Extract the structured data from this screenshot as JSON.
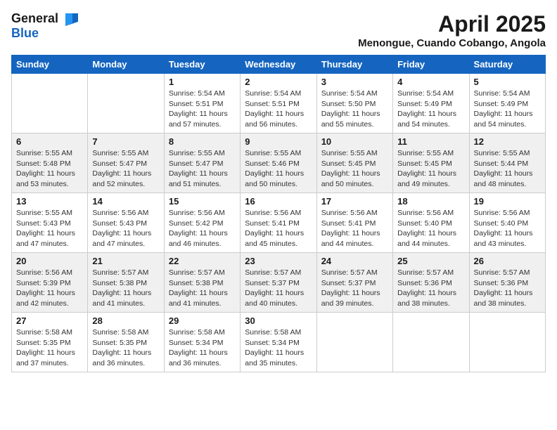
{
  "logo": {
    "general": "General",
    "blue": "Blue"
  },
  "title": "April 2025",
  "subtitle": "Menongue, Cuando Cobango, Angola",
  "days_header": [
    "Sunday",
    "Monday",
    "Tuesday",
    "Wednesday",
    "Thursday",
    "Friday",
    "Saturday"
  ],
  "weeks": [
    [
      {
        "num": "",
        "sunrise": "",
        "sunset": "",
        "daylight": ""
      },
      {
        "num": "",
        "sunrise": "",
        "sunset": "",
        "daylight": ""
      },
      {
        "num": "1",
        "sunrise": "Sunrise: 5:54 AM",
        "sunset": "Sunset: 5:51 PM",
        "daylight": "Daylight: 11 hours and 57 minutes."
      },
      {
        "num": "2",
        "sunrise": "Sunrise: 5:54 AM",
        "sunset": "Sunset: 5:51 PM",
        "daylight": "Daylight: 11 hours and 56 minutes."
      },
      {
        "num": "3",
        "sunrise": "Sunrise: 5:54 AM",
        "sunset": "Sunset: 5:50 PM",
        "daylight": "Daylight: 11 hours and 55 minutes."
      },
      {
        "num": "4",
        "sunrise": "Sunrise: 5:54 AM",
        "sunset": "Sunset: 5:49 PM",
        "daylight": "Daylight: 11 hours and 54 minutes."
      },
      {
        "num": "5",
        "sunrise": "Sunrise: 5:54 AM",
        "sunset": "Sunset: 5:49 PM",
        "daylight": "Daylight: 11 hours and 54 minutes."
      }
    ],
    [
      {
        "num": "6",
        "sunrise": "Sunrise: 5:55 AM",
        "sunset": "Sunset: 5:48 PM",
        "daylight": "Daylight: 11 hours and 53 minutes."
      },
      {
        "num": "7",
        "sunrise": "Sunrise: 5:55 AM",
        "sunset": "Sunset: 5:47 PM",
        "daylight": "Daylight: 11 hours and 52 minutes."
      },
      {
        "num": "8",
        "sunrise": "Sunrise: 5:55 AM",
        "sunset": "Sunset: 5:47 PM",
        "daylight": "Daylight: 11 hours and 51 minutes."
      },
      {
        "num": "9",
        "sunrise": "Sunrise: 5:55 AM",
        "sunset": "Sunset: 5:46 PM",
        "daylight": "Daylight: 11 hours and 50 minutes."
      },
      {
        "num": "10",
        "sunrise": "Sunrise: 5:55 AM",
        "sunset": "Sunset: 5:45 PM",
        "daylight": "Daylight: 11 hours and 50 minutes."
      },
      {
        "num": "11",
        "sunrise": "Sunrise: 5:55 AM",
        "sunset": "Sunset: 5:45 PM",
        "daylight": "Daylight: 11 hours and 49 minutes."
      },
      {
        "num": "12",
        "sunrise": "Sunrise: 5:55 AM",
        "sunset": "Sunset: 5:44 PM",
        "daylight": "Daylight: 11 hours and 48 minutes."
      }
    ],
    [
      {
        "num": "13",
        "sunrise": "Sunrise: 5:55 AM",
        "sunset": "Sunset: 5:43 PM",
        "daylight": "Daylight: 11 hours and 47 minutes."
      },
      {
        "num": "14",
        "sunrise": "Sunrise: 5:56 AM",
        "sunset": "Sunset: 5:43 PM",
        "daylight": "Daylight: 11 hours and 47 minutes."
      },
      {
        "num": "15",
        "sunrise": "Sunrise: 5:56 AM",
        "sunset": "Sunset: 5:42 PM",
        "daylight": "Daylight: 11 hours and 46 minutes."
      },
      {
        "num": "16",
        "sunrise": "Sunrise: 5:56 AM",
        "sunset": "Sunset: 5:41 PM",
        "daylight": "Daylight: 11 hours and 45 minutes."
      },
      {
        "num": "17",
        "sunrise": "Sunrise: 5:56 AM",
        "sunset": "Sunset: 5:41 PM",
        "daylight": "Daylight: 11 hours and 44 minutes."
      },
      {
        "num": "18",
        "sunrise": "Sunrise: 5:56 AM",
        "sunset": "Sunset: 5:40 PM",
        "daylight": "Daylight: 11 hours and 44 minutes."
      },
      {
        "num": "19",
        "sunrise": "Sunrise: 5:56 AM",
        "sunset": "Sunset: 5:40 PM",
        "daylight": "Daylight: 11 hours and 43 minutes."
      }
    ],
    [
      {
        "num": "20",
        "sunrise": "Sunrise: 5:56 AM",
        "sunset": "Sunset: 5:39 PM",
        "daylight": "Daylight: 11 hours and 42 minutes."
      },
      {
        "num": "21",
        "sunrise": "Sunrise: 5:57 AM",
        "sunset": "Sunset: 5:38 PM",
        "daylight": "Daylight: 11 hours and 41 minutes."
      },
      {
        "num": "22",
        "sunrise": "Sunrise: 5:57 AM",
        "sunset": "Sunset: 5:38 PM",
        "daylight": "Daylight: 11 hours and 41 minutes."
      },
      {
        "num": "23",
        "sunrise": "Sunrise: 5:57 AM",
        "sunset": "Sunset: 5:37 PM",
        "daylight": "Daylight: 11 hours and 40 minutes."
      },
      {
        "num": "24",
        "sunrise": "Sunrise: 5:57 AM",
        "sunset": "Sunset: 5:37 PM",
        "daylight": "Daylight: 11 hours and 39 minutes."
      },
      {
        "num": "25",
        "sunrise": "Sunrise: 5:57 AM",
        "sunset": "Sunset: 5:36 PM",
        "daylight": "Daylight: 11 hours and 38 minutes."
      },
      {
        "num": "26",
        "sunrise": "Sunrise: 5:57 AM",
        "sunset": "Sunset: 5:36 PM",
        "daylight": "Daylight: 11 hours and 38 minutes."
      }
    ],
    [
      {
        "num": "27",
        "sunrise": "Sunrise: 5:58 AM",
        "sunset": "Sunset: 5:35 PM",
        "daylight": "Daylight: 11 hours and 37 minutes."
      },
      {
        "num": "28",
        "sunrise": "Sunrise: 5:58 AM",
        "sunset": "Sunset: 5:35 PM",
        "daylight": "Daylight: 11 hours and 36 minutes."
      },
      {
        "num": "29",
        "sunrise": "Sunrise: 5:58 AM",
        "sunset": "Sunset: 5:34 PM",
        "daylight": "Daylight: 11 hours and 36 minutes."
      },
      {
        "num": "30",
        "sunrise": "Sunrise: 5:58 AM",
        "sunset": "Sunset: 5:34 PM",
        "daylight": "Daylight: 11 hours and 35 minutes."
      },
      {
        "num": "",
        "sunrise": "",
        "sunset": "",
        "daylight": ""
      },
      {
        "num": "",
        "sunrise": "",
        "sunset": "",
        "daylight": ""
      },
      {
        "num": "",
        "sunrise": "",
        "sunset": "",
        "daylight": ""
      }
    ]
  ]
}
